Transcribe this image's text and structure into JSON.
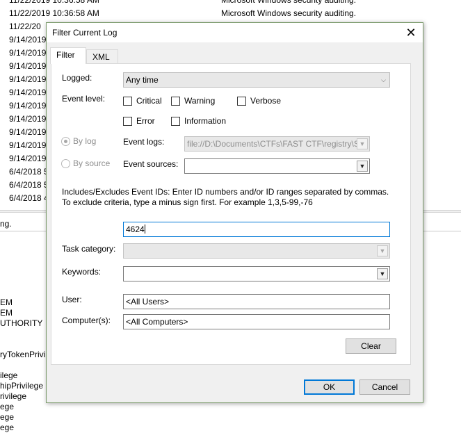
{
  "background": {
    "rows": [
      {
        "date": "11/22/2019 10:36:58 AM",
        "source": "Microsoft Windows security auditing."
      },
      {
        "date": "11/22/2019 10:36:58 AM",
        "source": "Microsoft Windows security auditing."
      },
      {
        "date": "11/22/20",
        "source": ""
      },
      {
        "date": "9/14/2019",
        "source": ""
      },
      {
        "date": "9/14/2019",
        "source": ""
      },
      {
        "date": "9/14/2019",
        "source": ""
      },
      {
        "date": "9/14/2019",
        "source": ""
      },
      {
        "date": "9/14/2019",
        "source": ""
      },
      {
        "date": "9/14/2019",
        "source": ""
      },
      {
        "date": "9/14/2019",
        "source": ""
      },
      {
        "date": "9/14/2019",
        "source": ""
      },
      {
        "date": "9/14/2019",
        "source": ""
      },
      {
        "date": "9/14/2019",
        "source": ""
      },
      {
        "date": "6/4/2018 5",
        "source": ""
      },
      {
        "date": "6/4/2018 5",
        "source": ""
      },
      {
        "date": "6/4/2018 4",
        "source": ""
      }
    ],
    "status_text": "ng.",
    "detail_lines": [
      "EM",
      "EM",
      "UTHORITY",
      "ryTokenPrivi",
      "ilege",
      "hipPrivilege",
      "rivilege",
      "ege",
      "ege",
      "ege"
    ]
  },
  "dialog": {
    "title": "Filter Current Log",
    "tabs": [
      {
        "label": "Filter",
        "active": true
      },
      {
        "label": "XML",
        "active": false
      }
    ],
    "logged": {
      "label": "Logged:",
      "value": "Any time"
    },
    "event_level": {
      "label": "Event level:",
      "critical": "Critical",
      "warning": "Warning",
      "verbose": "Verbose",
      "error": "Error",
      "information": "Information"
    },
    "by_log": {
      "label": "By log",
      "selected": true
    },
    "event_logs": {
      "label": "Event logs:",
      "value": "file://D:\\Documents\\CTFs\\FAST CTF\\registry\\S"
    },
    "by_source": {
      "label": "By source",
      "selected": false
    },
    "event_sources": {
      "label": "Event sources:",
      "value": ""
    },
    "description": "Includes/Excludes Event IDs: Enter ID numbers and/or ID ranges separated by commas. To exclude criteria, type a minus sign first. For example 1,3,5-99,-76",
    "event_ids": {
      "value": "4624"
    },
    "task_category": {
      "label": "Task category:",
      "value": ""
    },
    "keywords": {
      "label": "Keywords:",
      "value": ""
    },
    "user": {
      "label": "User:",
      "value": "<All Users>"
    },
    "computers": {
      "label": "Computer(s):",
      "value": "<All Computers>"
    },
    "clear_label": "Clear",
    "ok_label": "OK",
    "cancel_label": "Cancel"
  }
}
